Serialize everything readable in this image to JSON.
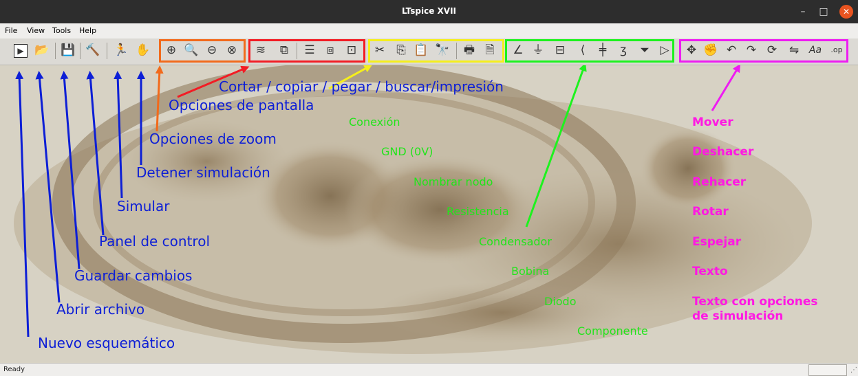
{
  "window": {
    "title": "LTspice XVII",
    "minimize_glyph": "–",
    "maximize_glyph": "□",
    "close_glyph": "✕"
  },
  "menu": {
    "file": "File",
    "view": "View",
    "tools": "Tools",
    "help": "Help"
  },
  "toolbar": {
    "icons": {
      "new_schematic": "▶",
      "open_file": "📂",
      "save": "💾",
      "control_panel": "🔨",
      "run": "🏃",
      "halt": "✋",
      "zoom_in": "⊕",
      "zoom_pan": "🔍",
      "zoom_out": "⊖",
      "zoom_fit": "⊗",
      "autorange": "≋",
      "tile_window": "⧉",
      "tile_h": "☰",
      "cascade": "⧈",
      "close_window": "⊡",
      "cut": "✂",
      "copy": "⎘",
      "paste": "📋",
      "find": "🔭",
      "print": "🖶",
      "print_setup": "🗎",
      "wire": "∠",
      "ground": "⏚",
      "label_net": "⊟",
      "resistor": "⟨",
      "capacitor": "╪",
      "inductor": "ʒ",
      "diode": "⏷",
      "component": "▷",
      "move": "✥",
      "drag": "✊",
      "undo": "↶",
      "redo": "↷",
      "rotate": "⟳",
      "mirror": "⇋",
      "text": "Aa",
      "spice_directive": ".op"
    },
    "group_colors": {
      "zoom": "#f26a1b",
      "display": "#f21c24",
      "edit": "#f5ef1c",
      "components": "#1df21e",
      "transform": "#ee1cf2"
    }
  },
  "annotations": {
    "blue": {
      "new_schematic": "Nuevo esquemático",
      "open_file": "Abrir archivo",
      "save": "Guardar cambios",
      "control_panel": "Panel de control",
      "simulate": "Simular",
      "stop_sim": "Detener simulación",
      "zoom": "Opciones de zoom",
      "screen": "Opciones de pantalla",
      "edit": "Cortar / copiar / pegar / buscar/impresión"
    },
    "green": {
      "wire": "Conexión",
      "ground": "GND (0V)",
      "net": "Nombrar nodo",
      "resistor": "Resistencia",
      "capacitor": "Condensador",
      "inductor": "Bobina",
      "diode": "Diodo",
      "component": "Componente"
    },
    "magenta": {
      "move": "Mover",
      "undo": "Deshacer",
      "redo": "Rehacer",
      "rotate": "Rotar",
      "mirror": "Espejar",
      "text": "Texto",
      "spice_line1": "Texto con opciones",
      "spice_line2": "de simulación"
    }
  },
  "status": {
    "text": "Ready"
  }
}
